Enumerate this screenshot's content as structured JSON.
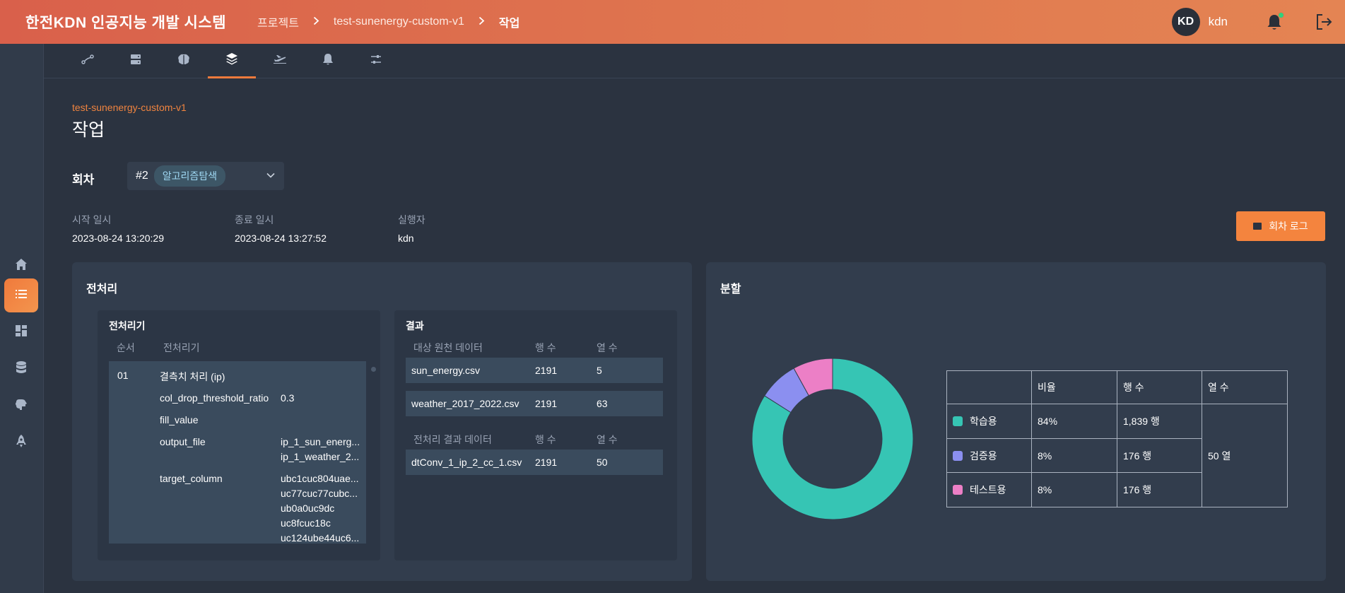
{
  "header": {
    "app_title": "한전KDN 인공지능 개발 시스템",
    "breadcrumb": [
      "프로젝트",
      "test-sunenergy-custom-v1",
      "작업"
    ],
    "avatar_initials": "KD",
    "username": "kdn",
    "brand_color": "#e0784f"
  },
  "sidebar": {
    "items": [
      {
        "icon": "home-icon"
      },
      {
        "icon": "list-icon",
        "active": true
      },
      {
        "icon": "dashboard-icon"
      },
      {
        "icon": "database-icon"
      },
      {
        "icon": "brain-icon"
      },
      {
        "icon": "rocket-icon"
      }
    ]
  },
  "tabs": [
    {
      "icon": "route-icon"
    },
    {
      "icon": "server-icon"
    },
    {
      "icon": "brain-icon"
    },
    {
      "icon": "layers-icon",
      "active": true
    },
    {
      "icon": "plane-icon"
    },
    {
      "icon": "bell-icon"
    },
    {
      "icon": "sliders-icon"
    }
  ],
  "page": {
    "project_name": "test-sunenergy-custom-v1",
    "title": "작업"
  },
  "round": {
    "label": "회차",
    "number": "#2",
    "badge": "알고리즘탐색"
  },
  "meta": {
    "start_label": "시작 일시",
    "start_value": "2023-08-24 13:20:29",
    "end_label": "종료 일시",
    "end_value": "2023-08-24 13:27:52",
    "runner_label": "실행자",
    "runner_value": "kdn"
  },
  "log_button": "회차 로그",
  "preprocess": {
    "title": "전처리",
    "preprocessor_panel": {
      "title": "전처리기",
      "col_order": "순서",
      "col_name": "전처리기",
      "step_no": "01",
      "step_name": "결측치 처리 (ip)",
      "params": [
        {
          "key": "col_drop_threshold_ratio",
          "values": [
            "0.3"
          ]
        },
        {
          "key": "fill_value",
          "values": []
        },
        {
          "key": "output_file",
          "values": [
            "ip_1_sun_energ...",
            "ip_1_weather_2..."
          ]
        },
        {
          "key": "target_column",
          "values": [
            "ubc1cuc804uae...",
            "uc77cuc77cubc...",
            "ub0a0uc9dc",
            "uc8fcuc18c",
            "uc124ube44uc6..."
          ]
        }
      ]
    },
    "result_panel": {
      "title": "결과",
      "source_header": [
        "대상 원천 데이터",
        "행 수",
        "열 수"
      ],
      "source_rows": [
        {
          "name": "sun_energy.csv",
          "rows": "2191",
          "cols": "5"
        },
        {
          "name": "weather_2017_2022.csv",
          "rows": "2191",
          "cols": "63"
        }
      ],
      "result_header": [
        "전처리 결과 데이터",
        "행 수",
        "열 수"
      ],
      "result_rows": [
        {
          "name": "dtConv_1_ip_2_cc_1.csv",
          "rows": "2191",
          "cols": "50"
        }
      ]
    }
  },
  "split": {
    "title": "분할",
    "table_header": [
      "",
      "비율",
      "행 수",
      "열 수"
    ],
    "rows": [
      {
        "name": "학습용",
        "ratio": "84%",
        "rows": "1,839 행",
        "color": "#36c5b4"
      },
      {
        "name": "검증용",
        "ratio": "8%",
        "rows": "176 행",
        "color": "#8b8ff0"
      },
      {
        "name": "테스트용",
        "ratio": "8%",
        "rows": "176 행",
        "color": "#ec7fc6"
      }
    ],
    "cols_value": "50 열"
  },
  "chart_data": {
    "type": "pie",
    "categories": [
      "학습용",
      "검증용",
      "테스트용"
    ],
    "values": [
      84,
      8,
      8
    ],
    "colors": [
      "#36c5b4",
      "#8b8ff0",
      "#ec7fc6"
    ],
    "donut": true
  }
}
